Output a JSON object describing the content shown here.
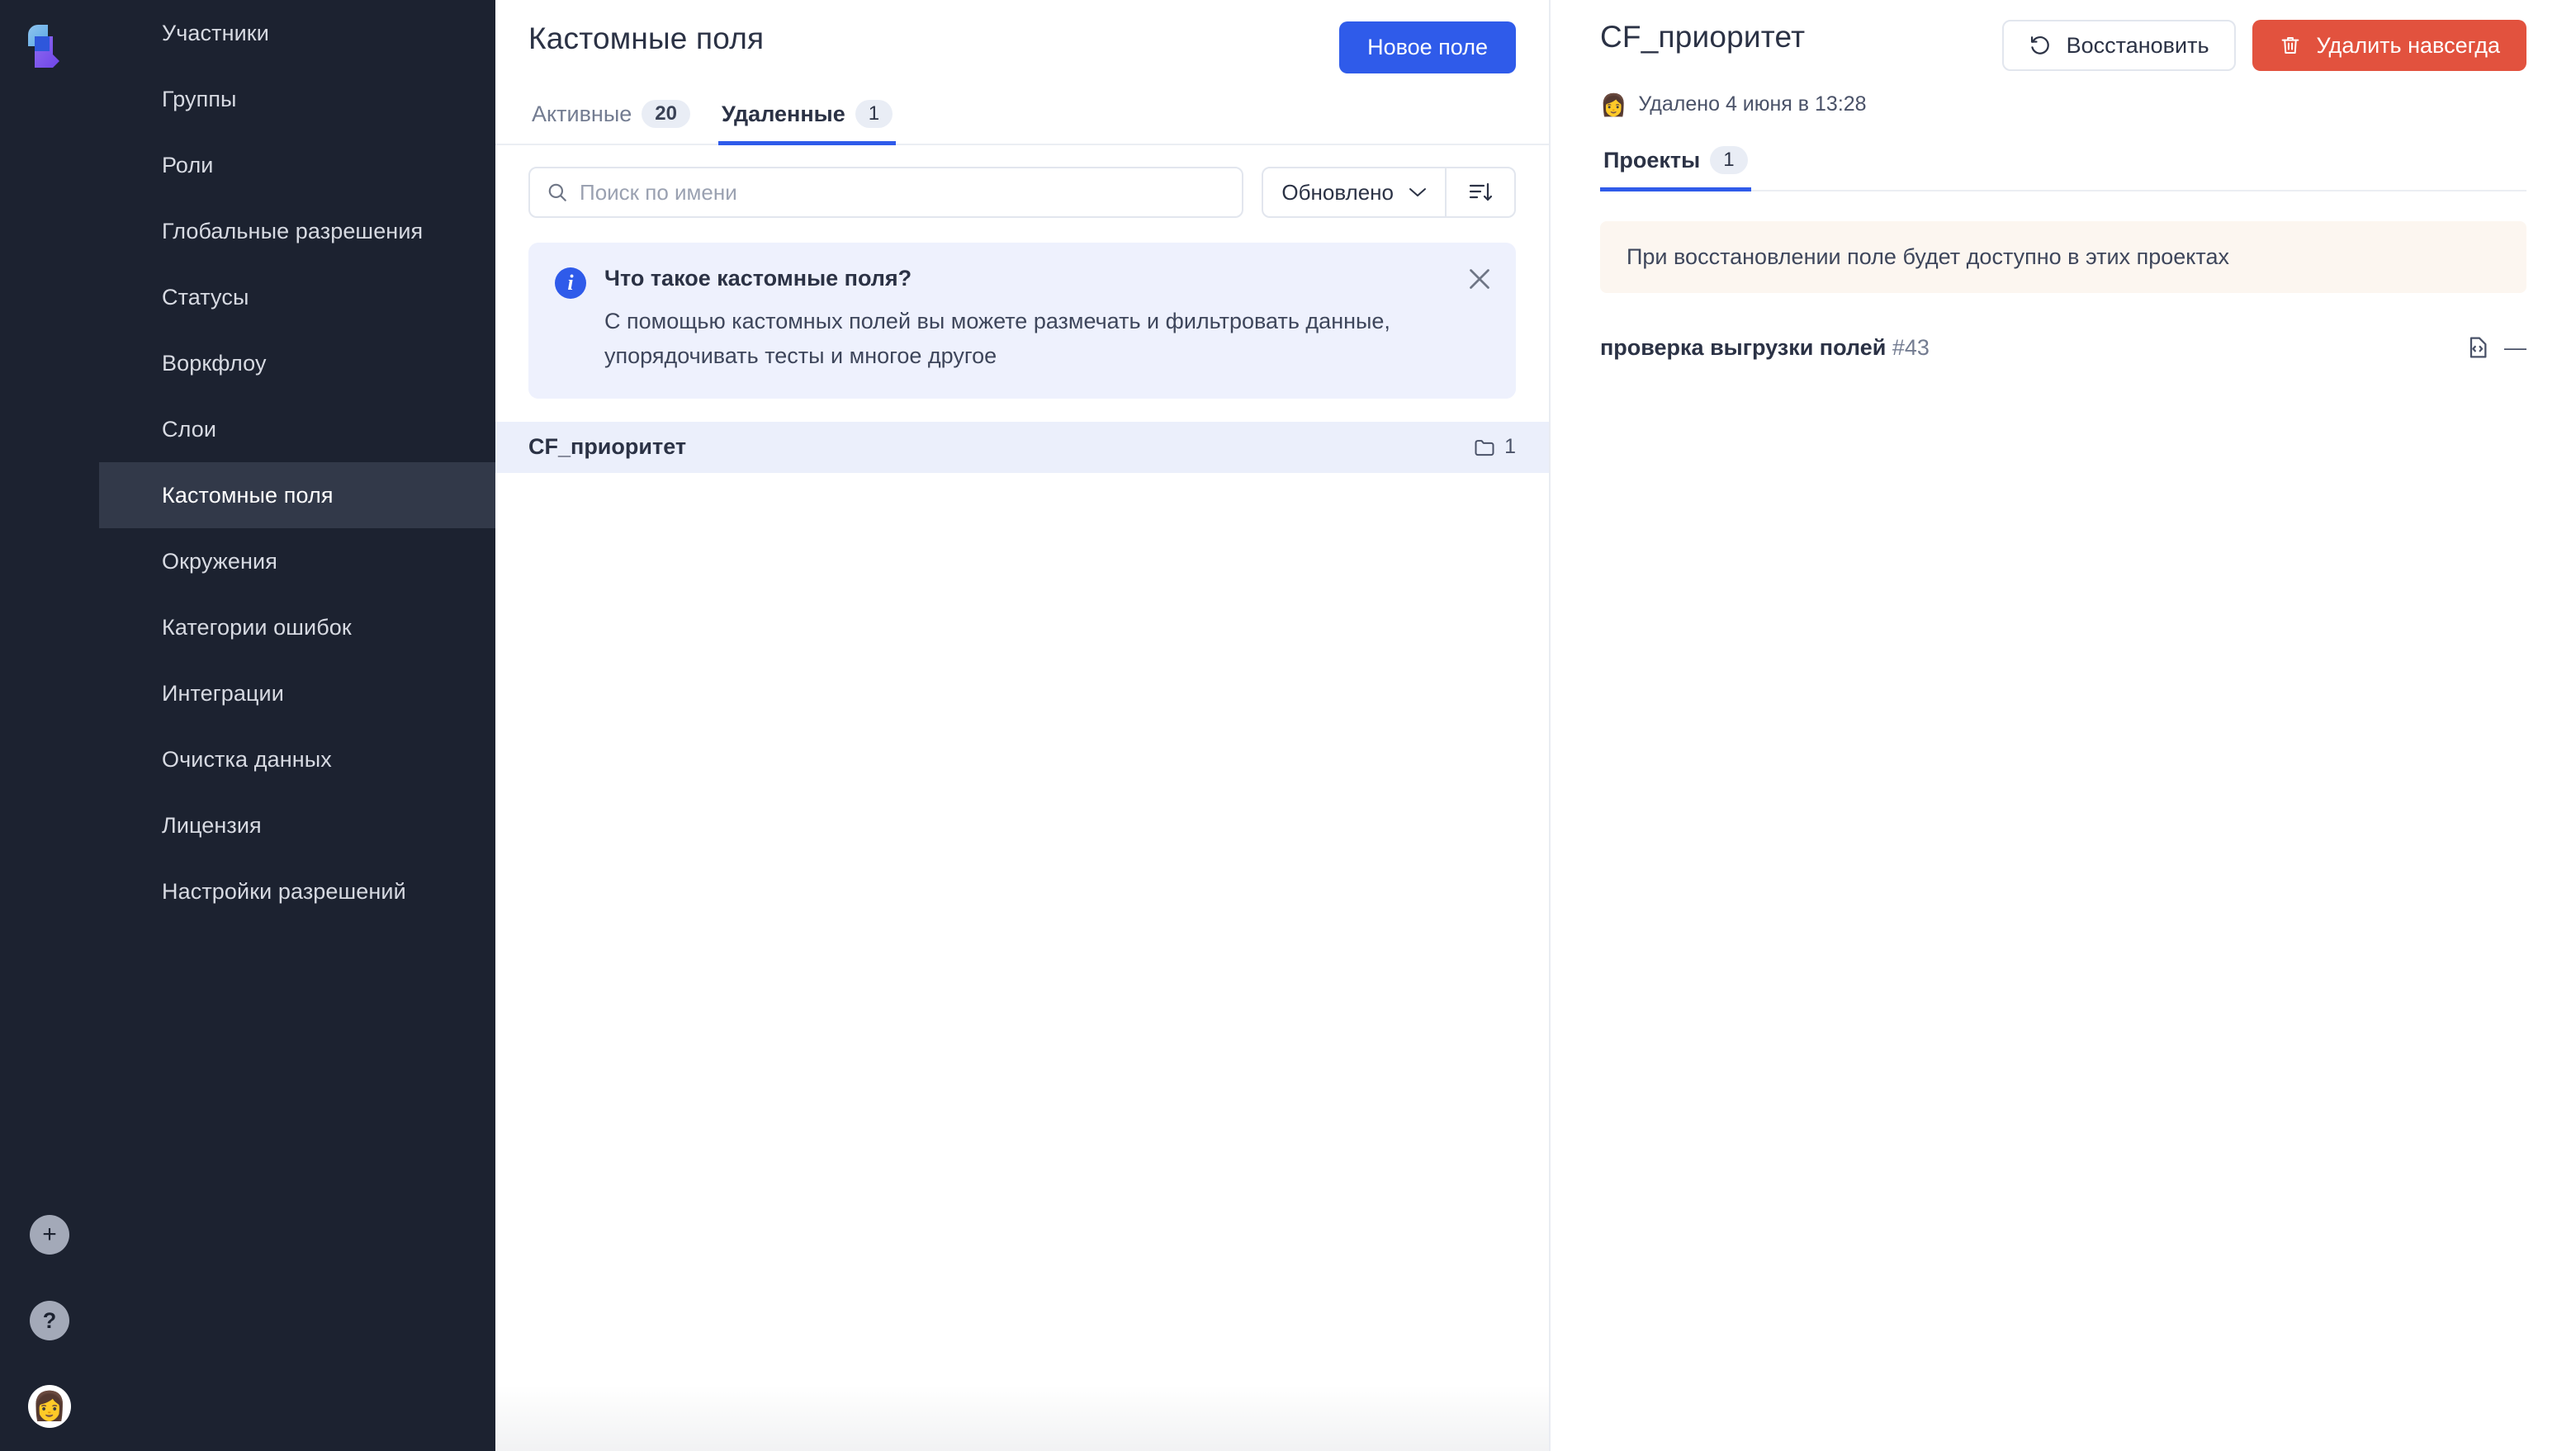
{
  "rail": {
    "logo_name": "app-logo",
    "add_label": "+",
    "help_label": "?",
    "avatar_glyph": "👩"
  },
  "sidebar": {
    "items": [
      {
        "label": "Участники",
        "active": false
      },
      {
        "label": "Группы",
        "active": false
      },
      {
        "label": "Роли",
        "active": false
      },
      {
        "label": "Глобальные разрешения",
        "active": false
      },
      {
        "label": "Статусы",
        "active": false
      },
      {
        "label": "Воркфлоу",
        "active": false
      },
      {
        "label": "Слои",
        "active": false
      },
      {
        "label": "Кастомные поля",
        "active": true
      },
      {
        "label": "Окружения",
        "active": false
      },
      {
        "label": "Категории ошибок",
        "active": false
      },
      {
        "label": "Интеграции",
        "active": false
      },
      {
        "label": "Очистка данных",
        "active": false
      },
      {
        "label": "Лицензия",
        "active": false
      },
      {
        "label": "Настройки разрешений",
        "active": false
      }
    ]
  },
  "list_panel": {
    "title": "Кастомные поля",
    "new_field_button": "Новое поле",
    "tabs": [
      {
        "label": "Активные",
        "count": "20",
        "active": false
      },
      {
        "label": "Удаленные",
        "count": "1",
        "active": true
      }
    ],
    "search": {
      "placeholder": "Поиск по имени",
      "value": ""
    },
    "sort": {
      "selected": "Обновлено",
      "direction_icon": "sort-descending-icon"
    },
    "info_banner": {
      "icon": "info-icon",
      "title": "Что такое кастомные поля?",
      "body": "С помощью кастомных полей вы можете размечать и фильтровать данные, упорядочивать тесты и многое другое",
      "close_icon": "close-icon"
    },
    "fields": [
      {
        "name": "CF_приоритет",
        "projects_count": "1",
        "selected": true
      }
    ]
  },
  "detail": {
    "title": "CF_приоритет",
    "restore_button": "Восстановить",
    "delete_button": "Удалить навсегда",
    "deleted_info": "Удалено 4 июня в 13:28",
    "deleted_avatar": "👩",
    "tabs": [
      {
        "label": "Проекты",
        "count": "1",
        "active": true
      }
    ],
    "notice": "При восстановлении поле будет доступно в этих проектах",
    "projects": [
      {
        "name": "проверка выгрузки полей",
        "id": "#43",
        "value": "—"
      }
    ]
  },
  "colors": {
    "accent": "#2F5BEA",
    "danger": "#E2523E",
    "sidebar_bg": "#1C2230",
    "selected_row": "#EBEFFB",
    "notice_bg": "#FCF6F0"
  }
}
